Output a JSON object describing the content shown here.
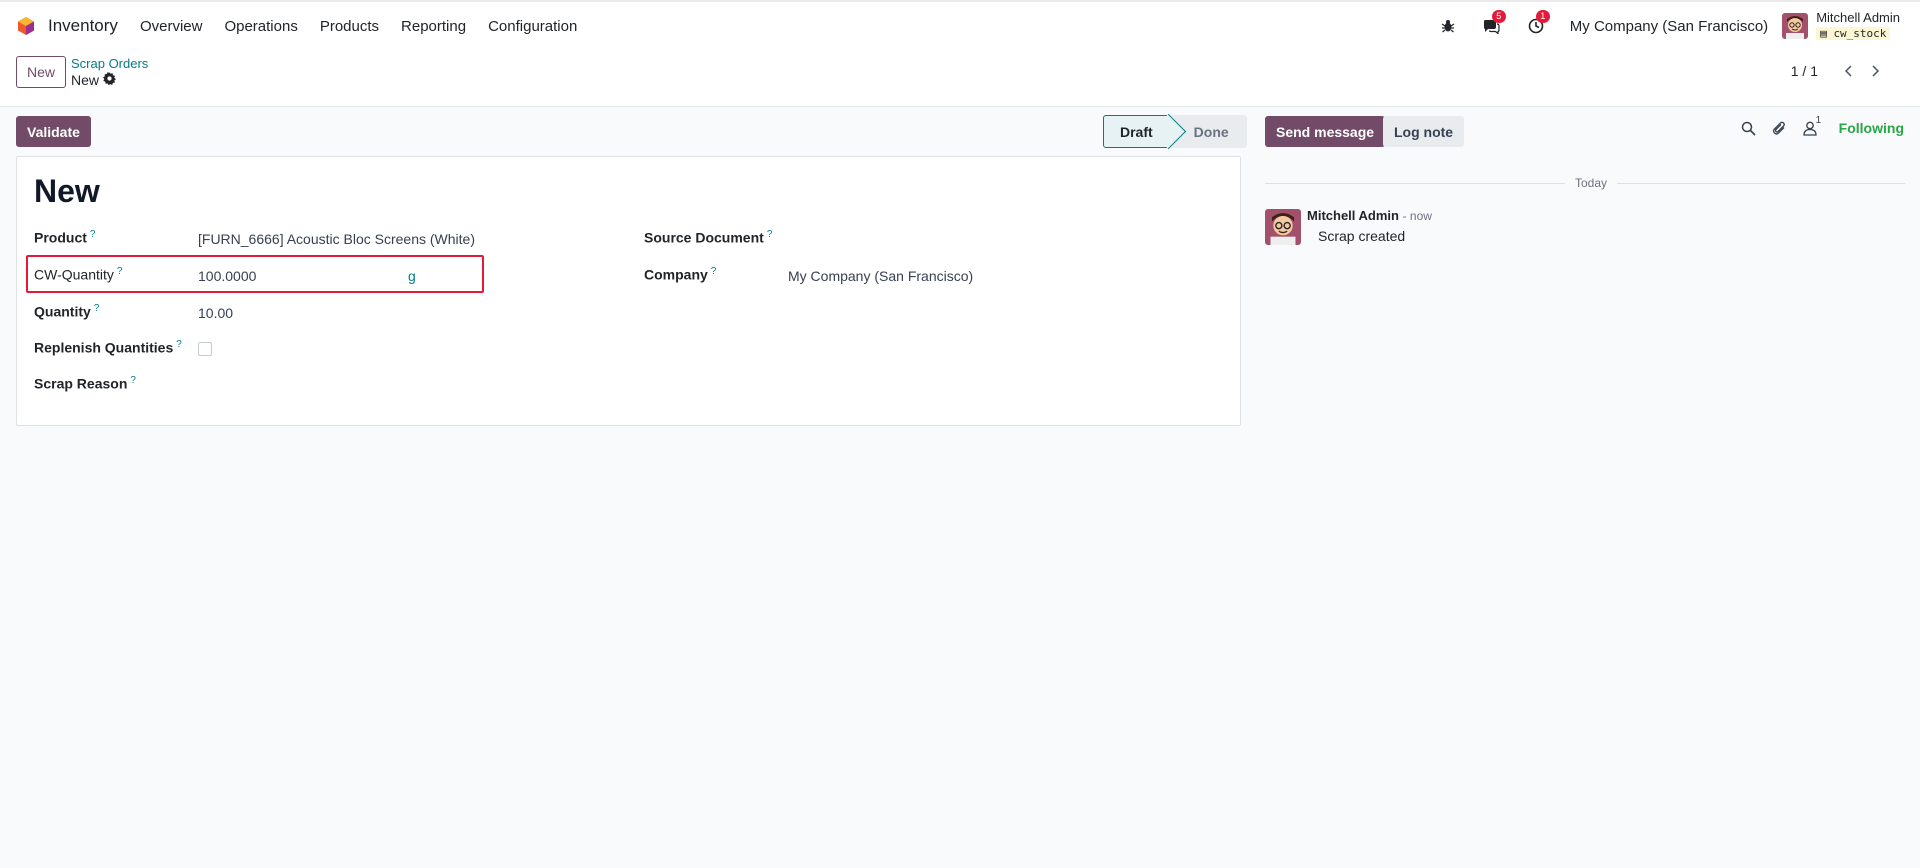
{
  "navbar": {
    "app_name": "Inventory",
    "menu": [
      "Overview",
      "Operations",
      "Products",
      "Reporting",
      "Configuration"
    ],
    "messages_count": "5",
    "activities_count": "1",
    "company": "My Company (San Francisco)",
    "user_name": "Mitchell Admin",
    "database": "cw_stock"
  },
  "control": {
    "new_label": "New",
    "breadcrumb_parent": "Scrap Orders",
    "breadcrumb_current": "New",
    "pager": "1 / 1"
  },
  "actions": {
    "validate_label": "Validate"
  },
  "statusbar": {
    "stages": [
      "Draft",
      "Done"
    ],
    "current": "Draft"
  },
  "form": {
    "title": "New",
    "help_mark": "?",
    "fields": {
      "product": {
        "label": "Product",
        "value": "[FURN_6666] Acoustic Bloc Screens (White)"
      },
      "cw_quantity": {
        "label": "CW-Quantity",
        "value": "100.0000",
        "uom": "g"
      },
      "quantity": {
        "label": "Quantity",
        "value": "10.00"
      },
      "replenish": {
        "label": "Replenish Quantities",
        "checked": false
      },
      "scrap_reason": {
        "label": "Scrap Reason",
        "value": ""
      },
      "source_document": {
        "label": "Source Document",
        "value": ""
      },
      "company": {
        "label": "Company",
        "value": "My Company (San Francisco)"
      }
    }
  },
  "chatter": {
    "send_message_label": "Send message",
    "log_note_label": "Log note",
    "followers_count": "1",
    "following_label": "Following",
    "date_separator": "Today",
    "messages": [
      {
        "author": "Mitchell Admin",
        "time": "- now",
        "body": "Scrap created"
      }
    ]
  },
  "colors": {
    "brand": "#714B67",
    "link": "#017e84",
    "highlight": "#e31b3a",
    "following": "#28a745"
  }
}
